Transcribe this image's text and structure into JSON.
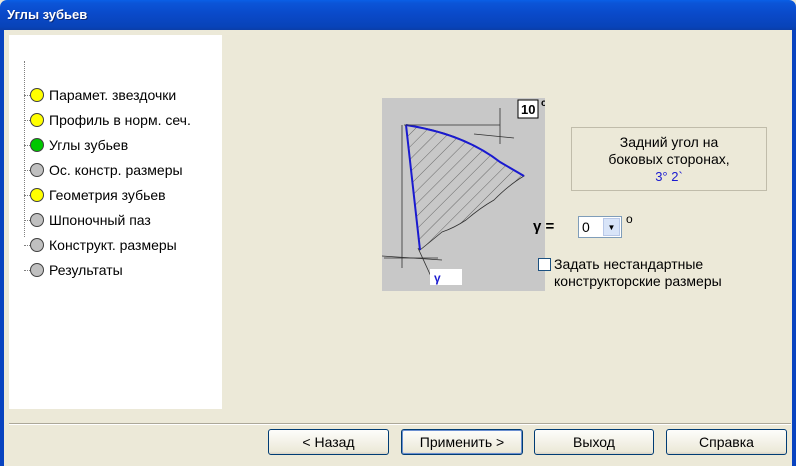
{
  "window": {
    "title": "Углы зубьев"
  },
  "tree": {
    "items": [
      {
        "label": "Парамет. звездочки",
        "status_color": "#ffff00"
      },
      {
        "label": "Профиль в норм. сеч.",
        "status_color": "#ffff00"
      },
      {
        "label": "Углы зубьев",
        "status_color": "#00c800"
      },
      {
        "label": "Ос. констр. размеры",
        "status_color": "#c0c0c0"
      },
      {
        "label": "Геометрия зубьев",
        "status_color": "#ffff00"
      },
      {
        "label": "Шпоночный паз",
        "status_color": "#c0c0c0"
      },
      {
        "label": "Конструкт. размеры",
        "status_color": "#c0c0c0"
      },
      {
        "label": "Результаты",
        "status_color": "#c0c0c0"
      }
    ]
  },
  "diagram": {
    "angle_label": "10",
    "degree_mark": "o",
    "gamma_label": "γ"
  },
  "info": {
    "line1": "Задний угол на",
    "line2": "боковых сторонах,",
    "value": "3° 2`"
  },
  "gamma": {
    "label": "γ =",
    "selected": "0",
    "unit": "o"
  },
  "option": {
    "line1": "Задать нестандартные",
    "line2": "конструкторские размеры",
    "checked": false
  },
  "buttons": {
    "back": "< Назад",
    "apply": "Применить >",
    "exit": "Выход",
    "help": "Справка"
  }
}
